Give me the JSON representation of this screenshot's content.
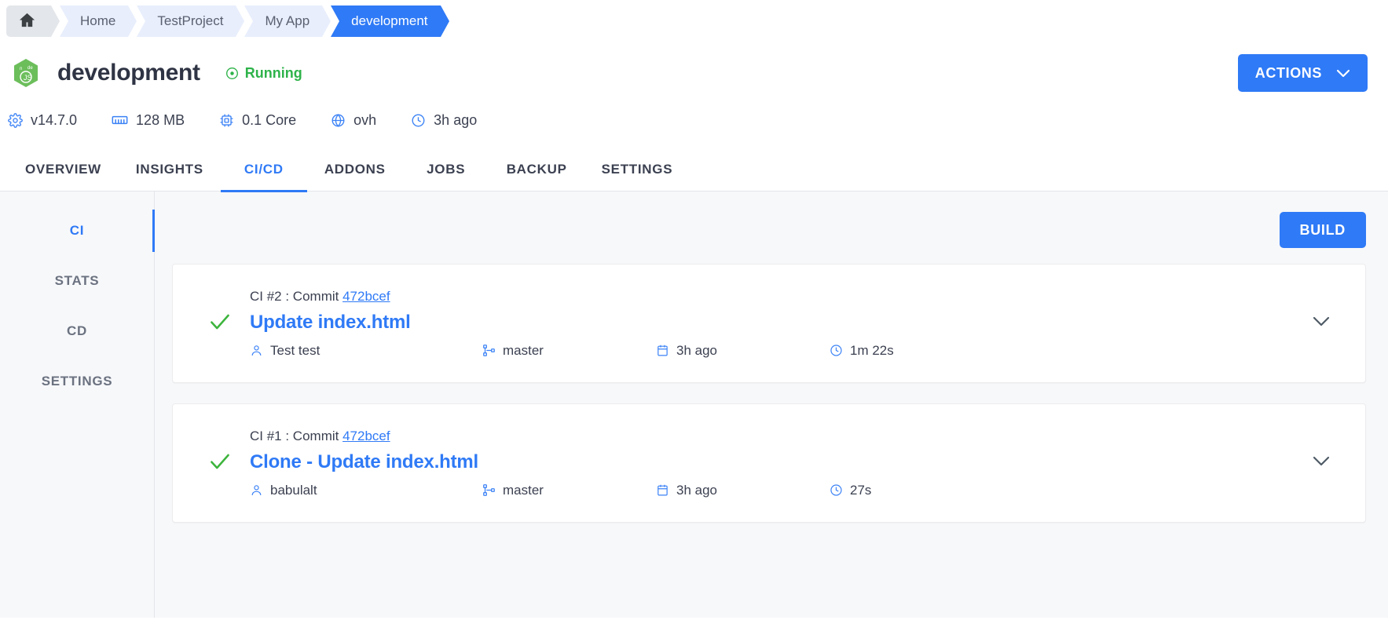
{
  "breadcrumb": {
    "home_icon": "home-icon",
    "items": [
      {
        "label": "Home",
        "active": false
      },
      {
        "label": "TestProject",
        "active": false
      },
      {
        "label": "My App",
        "active": false
      },
      {
        "label": "development",
        "active": true
      }
    ]
  },
  "header": {
    "logo_icon": "nodejs-logo-icon",
    "title": "development",
    "status": {
      "label": "Running",
      "icon": "status-dot-icon",
      "color": "#2eb34a"
    },
    "actions_button": {
      "label": "ACTIONS",
      "icon": "chevron-down-icon"
    }
  },
  "meta": [
    {
      "icon": "gear-icon",
      "label": "v14.7.0"
    },
    {
      "icon": "memory-icon",
      "label": "128 MB"
    },
    {
      "icon": "cpu-icon",
      "label": "0.1 Core"
    },
    {
      "icon": "globe-icon",
      "label": "ovh"
    },
    {
      "icon": "clock-icon",
      "label": "3h ago"
    }
  ],
  "tabs": [
    {
      "label": "OVERVIEW",
      "active": false
    },
    {
      "label": "INSIGHTS",
      "active": false
    },
    {
      "label": "CI/CD",
      "active": true
    },
    {
      "label": "ADDONS",
      "active": false
    },
    {
      "label": "JOBS",
      "active": false
    },
    {
      "label": "BACKUP",
      "active": false
    },
    {
      "label": "SETTINGS",
      "active": false
    }
  ],
  "sidenav": [
    {
      "label": "CI",
      "active": true
    },
    {
      "label": "STATS",
      "active": false
    },
    {
      "label": "CD",
      "active": false
    },
    {
      "label": "SETTINGS",
      "active": false
    }
  ],
  "content": {
    "build_button": {
      "label": "BUILD"
    },
    "pipelines": [
      {
        "status_icon": "check-icon",
        "sub_prefix": "CI #2 : Commit ",
        "commit": "472bcef",
        "title": "Update index.html",
        "author": "Test test",
        "branch": "master",
        "date": "3h ago",
        "duration": "1m 22s",
        "expand_icon": "chevron-down-icon",
        "author_icon": "person-icon",
        "branch_icon": "branch-icon",
        "date_icon": "calendar-icon",
        "duration_icon": "clock-icon"
      },
      {
        "status_icon": "check-icon",
        "sub_prefix": "CI #1 : Commit ",
        "commit": "472bcef",
        "title": "Clone - Update index.html",
        "author": "babulalt",
        "branch": "master",
        "date": "3h ago",
        "duration": "27s",
        "expand_icon": "chevron-down-icon",
        "author_icon": "person-icon",
        "branch_icon": "branch-icon",
        "date_icon": "calendar-icon",
        "duration_icon": "clock-icon"
      }
    ]
  },
  "colors": {
    "accent": "#2f7af6",
    "success": "#2eb34a",
    "text": "#3c4151",
    "muted": "#6b7280",
    "page_bg": "#f7f8fa"
  }
}
